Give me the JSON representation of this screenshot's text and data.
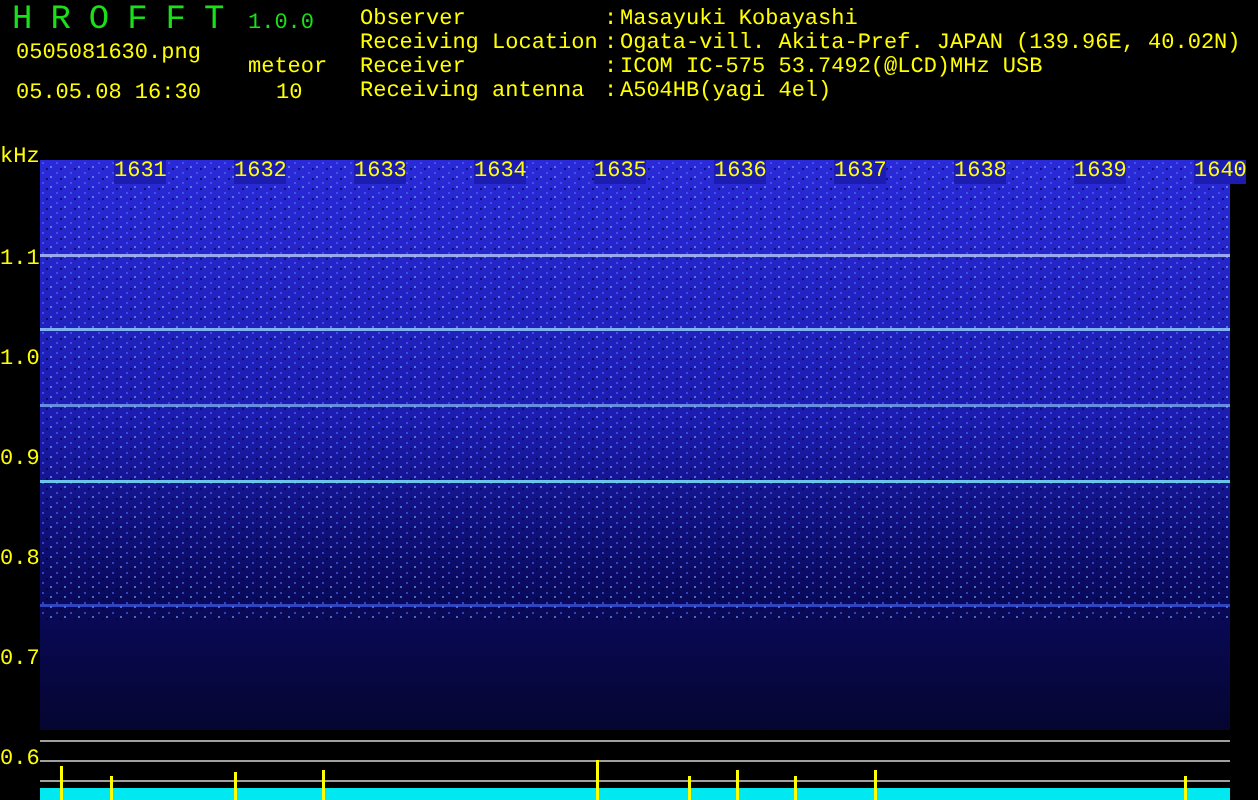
{
  "app": {
    "name": "HROFFT",
    "version": "1.0.0"
  },
  "file": {
    "name": "0505081630.png",
    "datetime": "05.05.08 16:30"
  },
  "meteor": {
    "label": "meteor",
    "count": "10"
  },
  "info": [
    {
      "label": "Observer",
      "value": "Masayuki Kobayashi"
    },
    {
      "label": "Receiving Location",
      "value": "Ogata-vill. Akita-Pref. JAPAN (139.96E, 40.02N)"
    },
    {
      "label": "Receiver",
      "value": "ICOM IC-575 53.7492(@LCD)MHz USB"
    },
    {
      "label": "Receiving antenna",
      "value": "A504HB(yagi 4el)"
    }
  ],
  "separator": ":",
  "y_axis": {
    "unit": "kHz",
    "ticks": [
      "1.1",
      "1.0",
      "0.9",
      "0.8",
      "0.7",
      "0.6"
    ]
  },
  "time_labels": [
    "1631",
    "1632",
    "1633",
    "1634",
    "1635",
    "1636",
    "1637",
    "1638",
    "1639",
    "1640"
  ]
}
